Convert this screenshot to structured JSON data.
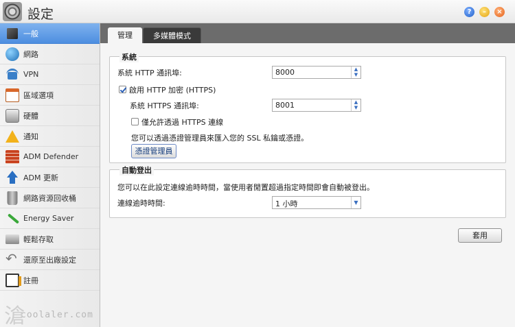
{
  "window": {
    "title": "設定",
    "help_glyph": "?",
    "min_glyph": "–",
    "close_glyph": "×"
  },
  "sidebar": {
    "items": [
      {
        "label": "一般",
        "icon": "server-icon",
        "active": true
      },
      {
        "label": "網路",
        "icon": "globe-icon"
      },
      {
        "label": "VPN",
        "icon": "vpn-icon"
      },
      {
        "label": "區域選項",
        "icon": "calendar-icon"
      },
      {
        "label": "硬體",
        "icon": "hard-drive-icon"
      },
      {
        "label": "通知",
        "icon": "warning-icon"
      },
      {
        "label": "ADM Defender",
        "icon": "firewall-icon"
      },
      {
        "label": "ADM 更新",
        "icon": "update-arrow-icon"
      },
      {
        "label": "網路資源回收桶",
        "icon": "recycle-bin-icon"
      },
      {
        "label": "Energy Saver",
        "icon": "energy-icon"
      },
      {
        "label": "輕鬆存取",
        "icon": "printer-icon"
      },
      {
        "label": "還原至出廠設定",
        "icon": "restore-icon"
      },
      {
        "label": "註冊",
        "icon": "register-icon"
      }
    ]
  },
  "watermark": {
    "text": "coolaler.com",
    "mark": "滄"
  },
  "tabs": [
    {
      "label": "管理",
      "active": true
    },
    {
      "label": "多媒體模式",
      "active": false
    }
  ],
  "system": {
    "legend": "系統",
    "http_port_label": "系統 HTTP 通訊埠:",
    "http_port_value": "8000",
    "https_enable_label": "啟用 HTTP 加密 (HTTPS)",
    "https_enable_checked": true,
    "https_port_label": "系統 HTTPS 通訊埠:",
    "https_port_value": "8001",
    "https_only_label": "僅允許透過 HTTPS 連線",
    "https_only_checked": false,
    "cert_hint": "您可以透過憑證管理員來匯入您的 SSL 私鑰或憑證。",
    "cert_button": "憑證管理員"
  },
  "auto_logout": {
    "legend": "自動登出",
    "hint": "您可以在此設定連線逾時時間，當使用者閒置超過指定時間即會自動被登出。",
    "timeout_label": "連線逾時時間:",
    "timeout_value": "1 小時"
  },
  "apply_button": "套用",
  "colors": {
    "active_sidebar": "#5a96e4",
    "tabbar": "#6c6c6c",
    "link_blue": "#2a5fb6"
  }
}
